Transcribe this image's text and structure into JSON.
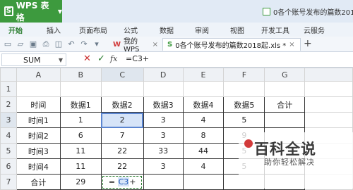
{
  "app": {
    "name": "WPS 表格",
    "doc_title": "0各个账号发布的篇数2018起"
  },
  "menu": [
    "开始",
    "插入",
    "页面布局",
    "公式",
    "数据",
    "审阅",
    "视图",
    "开发工具",
    "云服务"
  ],
  "tabs": [
    {
      "label": "我的WPS"
    },
    {
      "label": "0各个账号发布的篇数2018起.xls *"
    }
  ],
  "formula_bar": {
    "name_box": "SUM",
    "fx": "fx",
    "content": "=C3+"
  },
  "sheet": {
    "columns": [
      "A",
      "B",
      "C",
      "D",
      "E",
      "F",
      "G"
    ],
    "rows": [
      {
        "num": "1",
        "cells": [
          "",
          "",
          "",
          "",
          "",
          "",
          ""
        ]
      },
      {
        "num": "2",
        "cells": [
          "时间",
          "数据1",
          "数据2",
          "数据3",
          "数据4",
          "数据5",
          "合计"
        ]
      },
      {
        "num": "3",
        "cells": [
          "时间1",
          "1",
          "2",
          "3",
          "4",
          "5",
          ""
        ]
      },
      {
        "num": "4",
        "cells": [
          "时间2",
          "6",
          "7",
          "3",
          "8",
          "9",
          ""
        ]
      },
      {
        "num": "5",
        "cells": [
          "时间3",
          "11",
          "22",
          "33",
          "44",
          "5",
          ""
        ]
      },
      {
        "num": "6",
        "cells": [
          "时间4",
          "11",
          "22",
          "3",
          "4",
          "5",
          ""
        ]
      },
      {
        "num": "7",
        "cells": [
          "合计",
          "29",
          "",
          "",
          "",
          "",
          ""
        ]
      }
    ],
    "edit_cell": {
      "prefix": "=",
      "ref": "C3",
      "suffix": "+"
    }
  },
  "watermark": {
    "title": "百科全说",
    "subtitle": "助你轻松解决"
  },
  "colors": {
    "wps_green": "#3d9a3e",
    "selection": "#5b85d0"
  }
}
